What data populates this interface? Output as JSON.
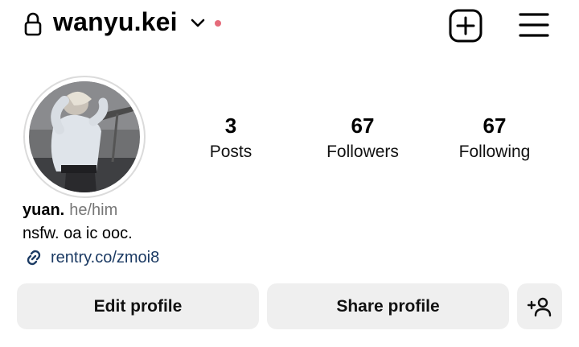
{
  "header": {
    "username": "wanyu.kei",
    "icons": [
      "lock-icon",
      "chevron-down-icon",
      "notification-dot",
      "add-post-icon",
      "menu-icon"
    ],
    "notification_dot_color": "#e56b7a"
  },
  "profile": {
    "avatar": "profile-photo",
    "stats": [
      {
        "value": "3",
        "label": "Posts"
      },
      {
        "value": "67",
        "label": "Followers"
      },
      {
        "value": "67",
        "label": "Following"
      }
    ],
    "display_name": "yuan.",
    "pronouns": "he/him",
    "bio": "nsfw. oa ic ooc.",
    "link": "rentry.co/zmoi8",
    "link_color": "#1b3a63"
  },
  "actions": {
    "edit_label": "Edit profile",
    "share_label": "Share profile",
    "add_person_icon": "add-person-icon"
  }
}
